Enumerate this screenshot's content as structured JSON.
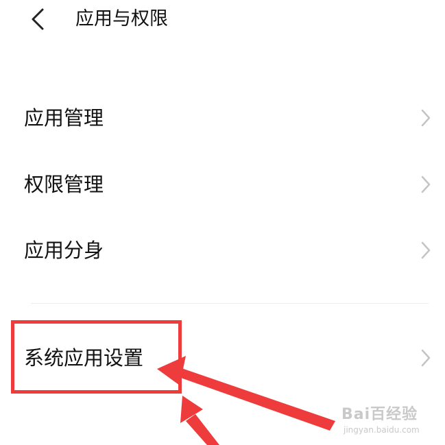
{
  "header": {
    "title": "应用与权限",
    "back_icon": "chevron-left-icon"
  },
  "menu": {
    "items": [
      {
        "label": "应用管理"
      },
      {
        "label": "权限管理"
      },
      {
        "label": "应用分身"
      },
      {
        "label": "系统应用设置"
      }
    ],
    "chevron_icon": "chevron-right-icon"
  },
  "annotation": {
    "color": "#ee3b3b"
  },
  "watermark": {
    "brand": "Bai百经验",
    "url": "jingyan.baidu.com"
  }
}
